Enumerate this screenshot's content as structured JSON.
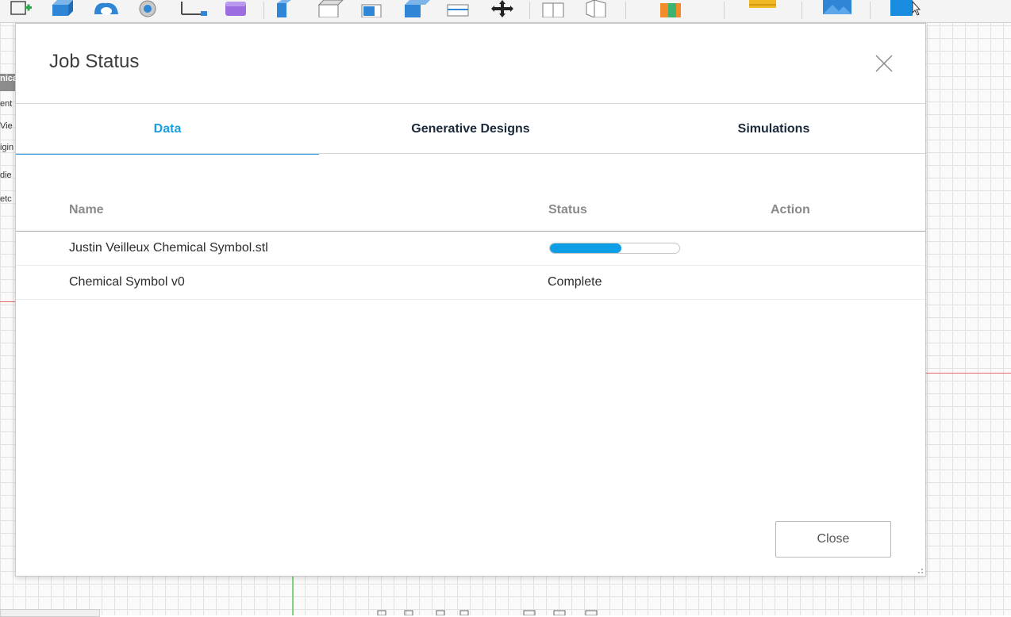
{
  "dialog": {
    "title": "Job Status",
    "tabs": [
      {
        "label": "Data",
        "active": true
      },
      {
        "label": "Generative Designs",
        "active": false
      },
      {
        "label": "Simulations",
        "active": false
      }
    ],
    "columns": {
      "name": "Name",
      "status": "Status",
      "action": "Action"
    },
    "rows": [
      {
        "name": "Justin Veilleux Chemical Symbol.stl",
        "status_progress": 0.55
      },
      {
        "name": "Chemical Symbol v0",
        "status": "Complete"
      }
    ],
    "close_label": "Close"
  },
  "side_panel": {
    "items": [
      "nica",
      "ent S",
      "Vie",
      "igin",
      "die",
      "etc"
    ]
  },
  "colors": {
    "accent": "#1a9ee0",
    "progress_fill": "#0e9ee6",
    "title_text": "#3c3c3c",
    "tab_text": "#1b2a3a"
  },
  "icons": {
    "toolbar": [
      "create-sketch-icon",
      "extrude-icon",
      "revolve-icon",
      "sweep-icon",
      "loft-icon",
      "box-primitive-icon",
      "press-pull-icon",
      "fillet-icon",
      "chamfer-icon",
      "shell-icon",
      "split-icon",
      "move-icon",
      "align-icon",
      "fold-icon",
      "appearance-icon",
      "measure-icon",
      "insert-image-icon",
      "select-icon"
    ]
  }
}
